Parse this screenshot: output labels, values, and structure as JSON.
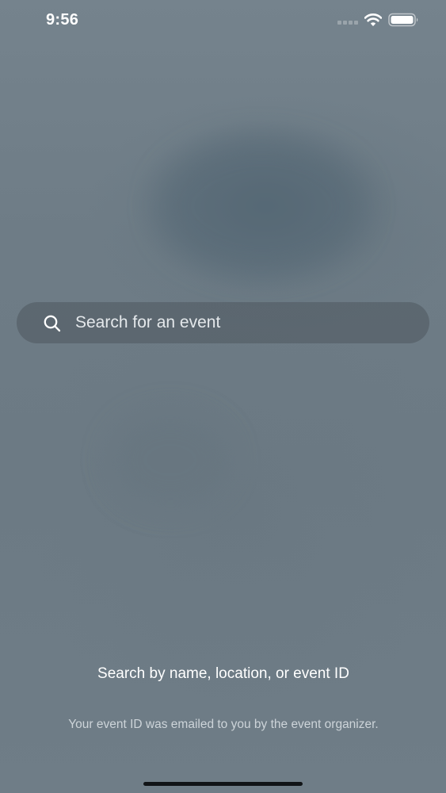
{
  "status_bar": {
    "time": "9:56",
    "icons": [
      "signal-icon",
      "wifi-icon",
      "battery-icon"
    ]
  },
  "search": {
    "placeholder": "Search for an event",
    "value": "",
    "icon": "search-icon"
  },
  "hint": {
    "title": "Search by name, location, or event ID",
    "subtitle": "Your event ID was emailed to you by the event organizer."
  },
  "colors": {
    "background": "#6f7d87",
    "search_bar": "#4e585f",
    "text_primary": "#ffffff",
    "text_secondary": "#cdd4d9"
  }
}
